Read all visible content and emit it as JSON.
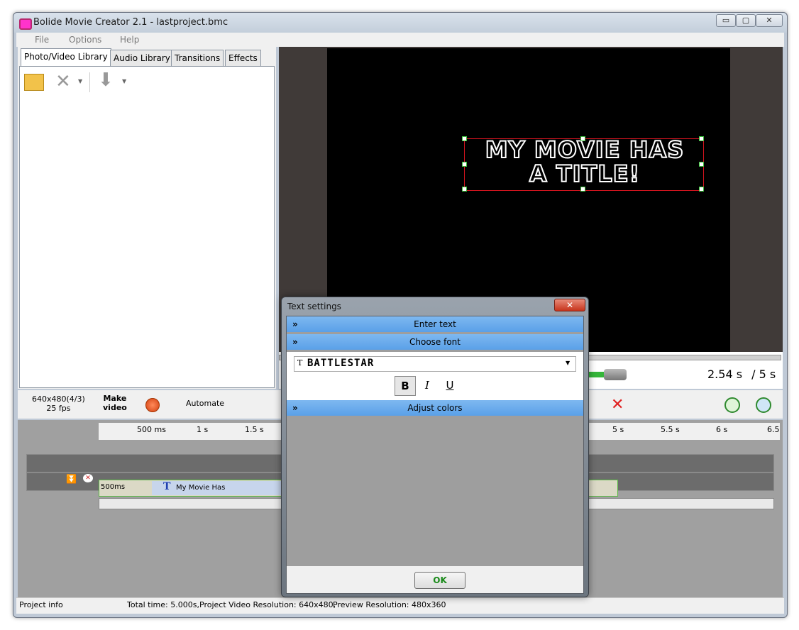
{
  "window": {
    "title": "Bolide Movie Creator 2.1 - lastproject.bmc",
    "minimize": "▭",
    "maximize": "▢",
    "close": "✕"
  },
  "menu": [
    "File",
    "Options",
    "Help"
  ],
  "tabs": [
    "Photo/Video Library",
    "Audio Library",
    "Transitions",
    "Effects"
  ],
  "preview": {
    "overlay_text_line1": "MY MOVIE HAS",
    "overlay_text_line2": "A TITLE!",
    "time_current": "2.54 s",
    "time_total": "/ 5 s"
  },
  "toolbar2": {
    "resolution": "640x480(4/3)",
    "fps": "25 fps",
    "make_video_1": "Make",
    "make_video_2": "video",
    "automate": "Automate"
  },
  "ruler": [
    "500 ms",
    "1 s",
    "1.5 s",
    "5 s",
    "5.5 s",
    "6 s",
    "6.5"
  ],
  "clip": {
    "duration": "500ms",
    "label": "My Movie Has"
  },
  "statusbar": {
    "project_info": "Project info",
    "total_time": "Total time: 5.000s,",
    "project_res": "Project Video Resolution:   640x480,",
    "preview_res": "Preview Resolution:   480x360"
  },
  "dialog": {
    "title": "Text settings",
    "close": "✕",
    "sections": [
      "Enter text",
      "Choose font",
      "Adjust colors"
    ],
    "font_name": "BATTLESTAR",
    "bold": "B",
    "italic": "I",
    "underline": "U",
    "ok": "OK"
  }
}
